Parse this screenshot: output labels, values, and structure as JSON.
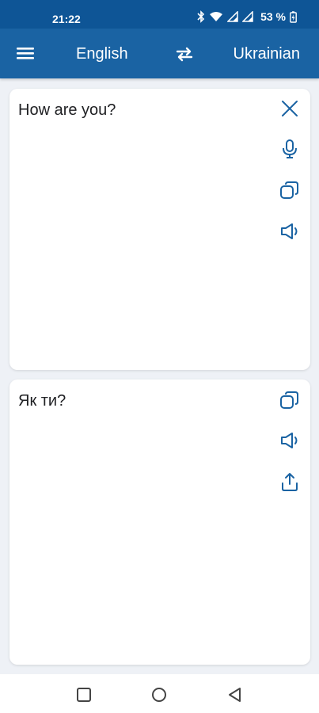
{
  "status_bar": {
    "time": "21:22",
    "battery": "53 %",
    "icons": [
      "bluetooth-icon",
      "wifi-icon",
      "signal-icon",
      "signal-icon",
      "battery-icon"
    ]
  },
  "app_bar": {
    "menu_icon": "hamburger-menu-icon",
    "source_language": "English",
    "swap_icon": "swap-arrows-icon",
    "target_language": "Ukrainian"
  },
  "source_card": {
    "text": "How are you?",
    "actions": [
      "close-icon",
      "microphone-icon",
      "copy-icon",
      "speaker-icon"
    ]
  },
  "result_card": {
    "text": "Як ти?",
    "actions": [
      "copy-icon",
      "speaker-icon",
      "share-icon"
    ]
  },
  "nav_bar": {
    "buttons": [
      "recents-square-icon",
      "home-circle-icon",
      "back-triangle-icon"
    ]
  },
  "colors": {
    "app_bar": "#1a63a3",
    "status_bar": "#0e5596",
    "icon": "#1a63a3",
    "background": "#eef1f6"
  }
}
